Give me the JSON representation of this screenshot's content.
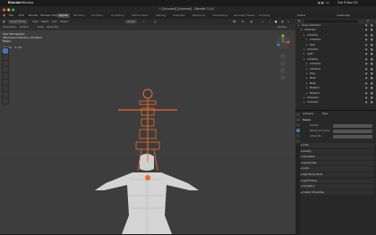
{
  "macbar": {
    "app_name": "Blender",
    "menu": "Window",
    "datetime": "Tue 9 Nov 22:"
  },
  "window_title": "* [Unsaved] [Unsaved] - Blender 3.4.0",
  "topbar": {
    "menus": [
      "File",
      "Edit",
      "Render",
      "Window",
      "Help"
    ],
    "workspaces": [
      "Layout",
      "Modeling",
      "Sculpting",
      "UV Editing",
      "Texture Paint",
      "Shading",
      "Animation",
      "Rendering",
      "Compositing",
      "Geometry Nodes",
      "Scripting"
    ],
    "active_workspace": "Layout",
    "scene": "Scene",
    "view_layer": "ViewLayer"
  },
  "viewport": {
    "mode": "Object Mode",
    "header_menus": [
      "View",
      "Select",
      "Add",
      "Object"
    ],
    "transform_orientation": "Global",
    "orientation_label": "Orientation:",
    "default_label": "Default",
    "drag_label": "Drag:",
    "select_box": "Select Box",
    "options_label": "Options",
    "overlay_lines": [
      "User Orthographic",
      "(26) Scene Collection | Armature",
      "Meters"
    ],
    "stats_label": "Objects",
    "stats_value": "0 / 14"
  },
  "outliner": {
    "search_placeholder": "",
    "rows": [
      {
        "label": "Scene Collection",
        "indent": 0
      },
      {
        "label": "Collection",
        "indent": 1
      },
      {
        "label": "Armature",
        "indent": 2
      },
      {
        "label": "Armature",
        "indent": 3
      },
      {
        "label": "Pose",
        "indent": 3
      },
      {
        "label": "Collection",
        "indent": 2
      },
      {
        "label": "Light",
        "indent": 2
      },
      {
        "label": "Armature",
        "indent": 2
      },
      {
        "label": "Armature",
        "indent": 3
      },
      {
        "label": "Armature",
        "indent": 3
      },
      {
        "label": "Pose",
        "indent": 3
      },
      {
        "label": "Mesh",
        "indent": 3
      },
      {
        "label": "Mesh",
        "indent": 3
      },
      {
        "label": "Material",
        "indent": 3
      },
      {
        "label": "Material",
        "indent": 3
      },
      {
        "label": "Collection",
        "indent": 2
      },
      {
        "label": "Collection",
        "indent": 2
      }
    ]
  },
  "properties": {
    "tabs": [
      "Armature",
      "Pose"
    ],
    "section": "Scene",
    "fields": [
      {
        "label": "Camera",
        "value": ""
      },
      {
        "label": "Background Scene",
        "value": ""
      },
      {
        "label": "Active Clip",
        "value": ""
      }
    ],
    "subsections": [
      "Units",
      "Gravity",
      "Simulation",
      "Keying Sets",
      "Audio",
      "Rigid Body World",
      "Light Probes",
      "Animation",
      "Custom Properties"
    ]
  }
}
